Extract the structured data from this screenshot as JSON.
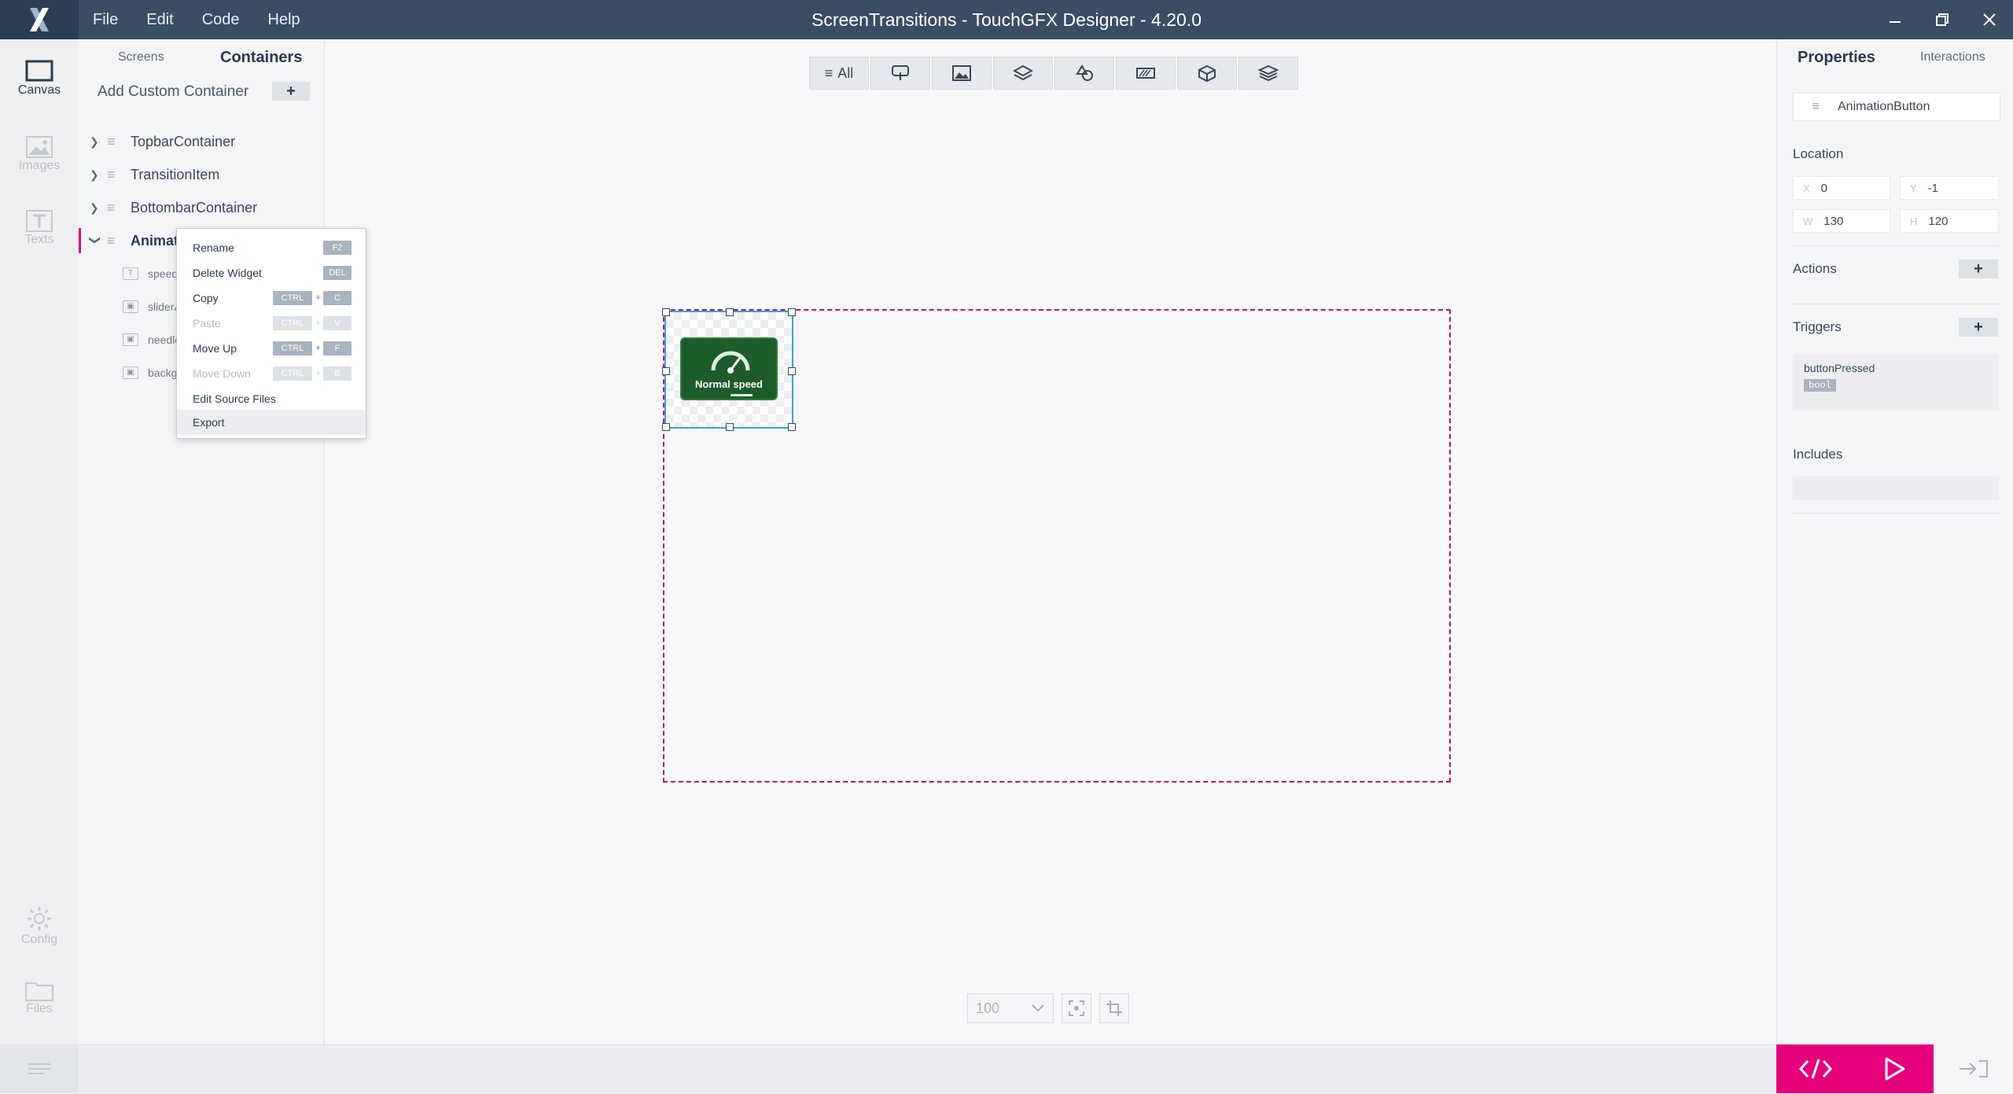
{
  "window": {
    "title": "ScreenTransitions - TouchGFX Designer - 4.20.0",
    "menu": [
      "File",
      "Edit",
      "Code",
      "Help"
    ]
  },
  "rail": {
    "items": [
      "Canvas",
      "Images",
      "Texts",
      "Config",
      "Files"
    ]
  },
  "tree": {
    "tabs": [
      "Screens",
      "Containers"
    ],
    "add_label": "Add Custom Container",
    "add_button": "+",
    "items": [
      "TopbarContainer",
      "TransitionItem",
      "BottombarContainer",
      "AnimationButton"
    ],
    "children": [
      "speedT",
      "sliderA",
      "needle",
      "backgr"
    ]
  },
  "context_menu": {
    "items": [
      {
        "label": "Rename",
        "keys": [
          "F2"
        ]
      },
      {
        "label": "Delete Widget",
        "keys": [
          "DEL"
        ]
      },
      {
        "label": "Copy",
        "keys": [
          "CTRL",
          "C"
        ]
      },
      {
        "label": "Paste",
        "keys": [
          "CTRL",
          "V"
        ]
      },
      {
        "label": "Move Up",
        "keys": [
          "CTRL",
          "F"
        ]
      },
      {
        "label": "Move Down",
        "keys": [
          "CTRL",
          "B"
        ]
      },
      {
        "label": "Edit Source Files",
        "keys": []
      },
      {
        "label": "Export",
        "keys": []
      }
    ],
    "plus": "+"
  },
  "canvas": {
    "filter_all": "All",
    "widget_label": "Normal speed",
    "zoom": "100"
  },
  "properties": {
    "tabs": [
      "Properties",
      "Interactions"
    ],
    "name": "AnimationButton",
    "location_label": "Location",
    "x_key": "X",
    "x": "0",
    "y_key": "Y",
    "y": "-1",
    "w_key": "W",
    "w": "130",
    "h_key": "H",
    "h": "120",
    "actions_label": "Actions",
    "triggers_label": "Triggers",
    "trigger_name": "buttonPressed",
    "trigger_type": "bool",
    "includes_label": "Includes",
    "plus": "+"
  },
  "colors": {
    "titlebar": "#3a4d63",
    "accent": "#e6007e",
    "selection": "#3aa3e3",
    "screen_border": "#c4145a",
    "button_green": "#1e5b2b"
  }
}
